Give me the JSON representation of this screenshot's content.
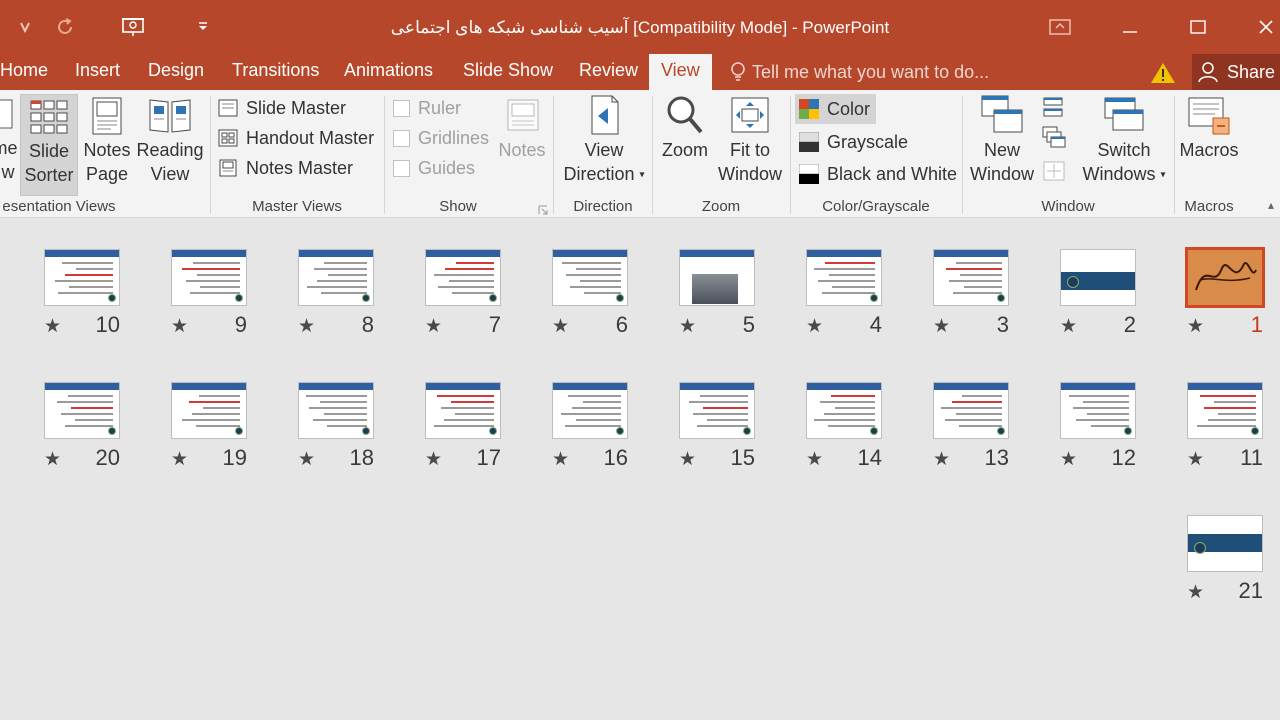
{
  "window": {
    "title": "آسیب شناسی شبکه های اجتماعی [Compatibility Mode] - PowerPoint",
    "accent_color": "#b7472a",
    "controls": [
      "ribbon-display-options",
      "minimize",
      "maximize",
      "close"
    ]
  },
  "quick_access": [
    "save-icon",
    "redo-icon",
    "present-icon",
    "customize-icon"
  ],
  "tabs": [
    {
      "label": "Home"
    },
    {
      "label": "Insert"
    },
    {
      "label": "Design"
    },
    {
      "label": "Transitions"
    },
    {
      "label": "Animations"
    },
    {
      "label": "Slide Show"
    },
    {
      "label": "Review"
    },
    {
      "label": "View",
      "active": true
    }
  ],
  "tellme": {
    "placeholder": "Tell me what you want to do..."
  },
  "share": {
    "label": "Share"
  },
  "ribbon": {
    "presentation_views": {
      "label": "esentation Views",
      "partial_normal": {
        "line1": "me",
        "line2": "w"
      },
      "slide_sorter": {
        "line1": "Slide",
        "line2": "Sorter"
      },
      "notes_page": {
        "line1": "Notes",
        "line2": "Page"
      },
      "reading_view": {
        "line1": "Reading",
        "line2": "View"
      }
    },
    "master_views": {
      "label": "Master Views",
      "slide_master": "Slide Master",
      "handout_master": "Handout Master",
      "notes_master": "Notes Master"
    },
    "show": {
      "label": "Show",
      "ruler": "Ruler",
      "gridlines": "Gridlines",
      "guides": "Guides",
      "notes": "Notes"
    },
    "direction": {
      "label": "Direction",
      "view_direction": {
        "line1": "View",
        "line2": "Direction"
      }
    },
    "zoom": {
      "label": "Zoom",
      "zoom": "Zoom",
      "fit_to_window": {
        "line1": "Fit to",
        "line2": "Window"
      }
    },
    "color_grayscale": {
      "label": "Color/Grayscale",
      "color": "Color",
      "grayscale": "Grayscale",
      "black_and_white": "Black and White"
    },
    "window": {
      "label": "Window",
      "new_window": {
        "line1": "New",
        "line2": "Window"
      },
      "switch_windows": {
        "line1": "Switch",
        "line2": "Windows"
      }
    },
    "macros": {
      "label": "Macros",
      "macros": "Macros"
    }
  },
  "slides": [
    {
      "number": "1",
      "selected": true
    },
    {
      "number": "2"
    },
    {
      "number": "3"
    },
    {
      "number": "4"
    },
    {
      "number": "5"
    },
    {
      "number": "6"
    },
    {
      "number": "7"
    },
    {
      "number": "8"
    },
    {
      "number": "9"
    },
    {
      "number": "10"
    },
    {
      "number": "11"
    },
    {
      "number": "12"
    },
    {
      "number": "13"
    },
    {
      "number": "14"
    },
    {
      "number": "15"
    },
    {
      "number": "16"
    },
    {
      "number": "17"
    },
    {
      "number": "18"
    },
    {
      "number": "19"
    },
    {
      "number": "20"
    },
    {
      "number": "21"
    }
  ],
  "slide_star": "★"
}
